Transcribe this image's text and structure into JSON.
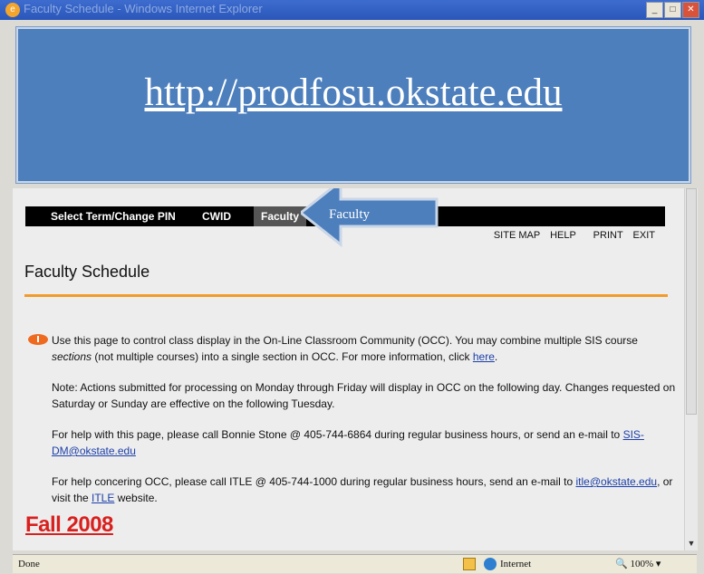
{
  "window": {
    "title": "Faculty Schedule - Windows Internet Explorer"
  },
  "banner": {
    "url": "http://prodfosu.okstate.edu"
  },
  "nav": {
    "items": [
      {
        "label": "Select Term/Change PIN"
      },
      {
        "label": "CWID"
      },
      {
        "label": "Faculty"
      }
    ],
    "callout": "Faculty"
  },
  "toplinks": [
    "SITE MAP",
    "HELP",
    "PRINT",
    "EXIT"
  ],
  "page": {
    "title": "Faculty Schedule",
    "p1_a": "Use this page to control class display in the On-Line Classroom Community (OCC).  You may combine multiple SIS course",
    "p1_b_italic": "sections",
    "p1_b_rest": " (not multiple courses) into a single section in OCC.  For more information, click ",
    "p1_link": "here",
    "p1_end": ".",
    "p2_a": "Note: Actions submitted for processing on Monday through Friday will display in OCC on the following day.  Changes requested on",
    "p2_b": "Saturday or Sunday are effective on the following Tuesday.",
    "p3_a": "For help with this page, please call Bonnie Stone @ 405-744-6864 during regular business hours, or send an e-mail to ",
    "p3_link1": "SIS-",
    "p3_link2": "DM@okstate.edu",
    "p4_a": "For help concering OCC, please call ITLE @ 405-744-1000 during regular business hours, send an e-mail to ",
    "p4_link": "itle@okstate.edu",
    "p4_b": ", or",
    "p4_c": "visit the ",
    "p4_link2": "ITLE",
    "p4_d": " website.",
    "fall": "Fall 2008"
  },
  "status": {
    "done": "Done",
    "zone": "Internet",
    "zoom": "100%"
  },
  "colors": {
    "banner": "#4d7fbd",
    "rule": "#f29a2a",
    "fall": "#d9201e",
    "nav": "#000000"
  }
}
